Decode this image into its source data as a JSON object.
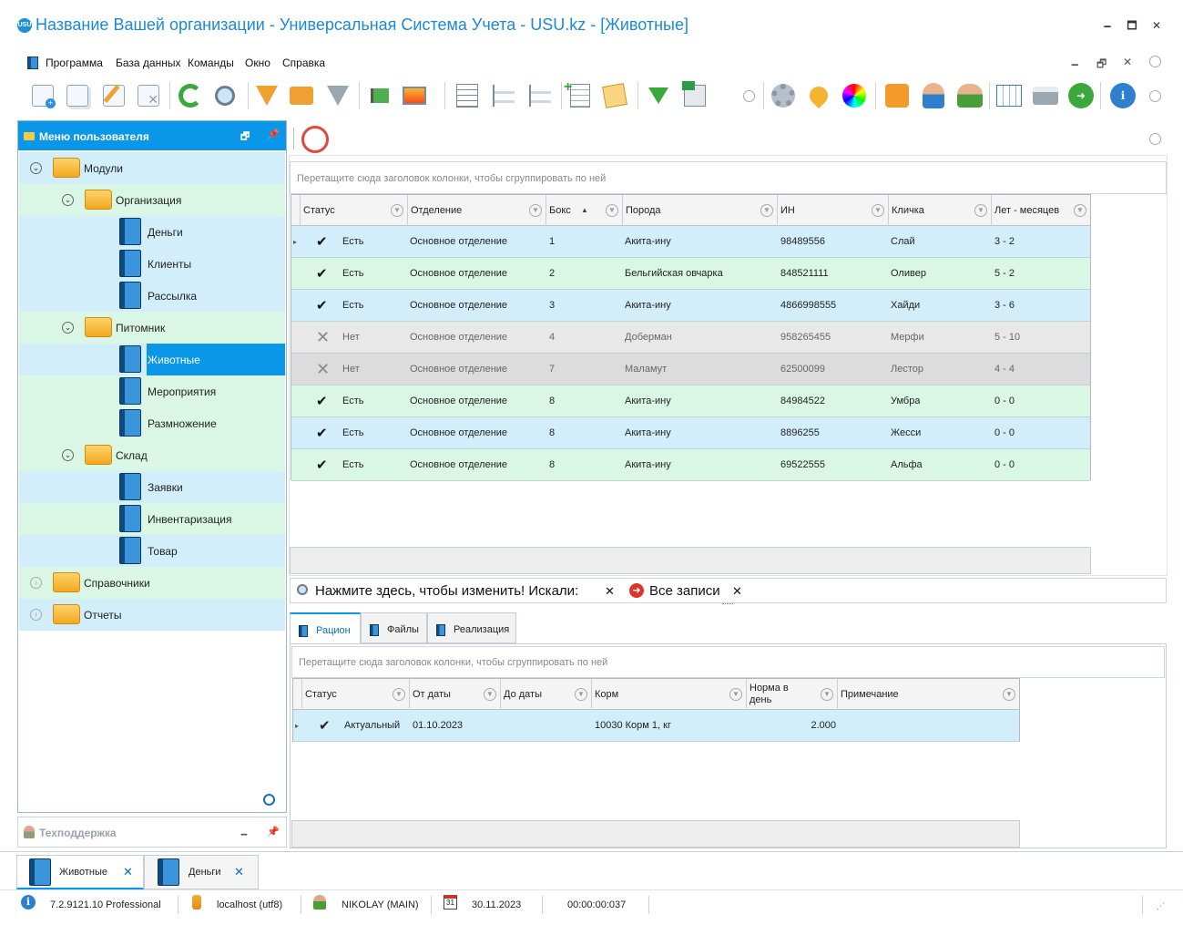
{
  "window": {
    "title": "Название Вашей организации - Универсальная Система Учета - USU.kz - [Животные]",
    "logo_text": "USU",
    "minimize": "🗕",
    "maximize": "🗖",
    "close": "✕"
  },
  "menu": {
    "items": [
      "Программа",
      "База данных",
      "Команды",
      "Окно",
      "Справка"
    ],
    "mdi_minimize": "🗕",
    "mdi_restore": "🗗",
    "mdi_close": "✕"
  },
  "toolbar": {
    "icons": [
      "add-icon",
      "copy-icon",
      "edit-icon",
      "delete-icon",
      "refresh-icon",
      "search-icon",
      "filter-icon",
      "filter-edit-icon",
      "filter-check-icon",
      "flag-icon",
      "image-icon",
      "tree-expand-icon",
      "tree-down-icon",
      "tree-up-icon",
      "add-row-icon",
      "notes-icon",
      "download-icon",
      "export-excel-icon",
      "settings-icon",
      "map-pin-icon",
      "color-wheel-icon",
      "rss-icon",
      "user-icon",
      "users-icon",
      "table-icon",
      "print-icon",
      "arrow-right-icon",
      "info-icon"
    ]
  },
  "left_panel": {
    "title": "Меню пользователя",
    "tree": [
      {
        "label": "Модули",
        "level": 0,
        "type": "folder"
      },
      {
        "label": "Организация",
        "level": 1,
        "type": "folder"
      },
      {
        "label": "Деньги",
        "level": 2,
        "type": "book"
      },
      {
        "label": "Клиенты",
        "level": 2,
        "type": "book"
      },
      {
        "label": "Рассылка",
        "level": 2,
        "type": "book"
      },
      {
        "label": "Питомник",
        "level": 1,
        "type": "folder"
      },
      {
        "label": "Животные",
        "level": 2,
        "type": "book",
        "selected": true
      },
      {
        "label": "Мероприятия",
        "level": 2,
        "type": "book"
      },
      {
        "label": "Размножение",
        "level": 2,
        "type": "book"
      },
      {
        "label": "Склад",
        "level": 1,
        "type": "folder"
      },
      {
        "label": "Заявки",
        "level": 2,
        "type": "book"
      },
      {
        "label": "Инвентаризация",
        "level": 2,
        "type": "book"
      },
      {
        "label": "Товар",
        "level": 2,
        "type": "book"
      },
      {
        "label": "Справочники",
        "level": 0,
        "type": "folder"
      },
      {
        "label": "Отчеты",
        "level": 0,
        "type": "folder"
      }
    ],
    "support_title": "Техподдержка"
  },
  "main_grid": {
    "group_hint": "Перетащите сюда заголовок колонки, чтобы сгруппировать по ней",
    "columns": [
      "Статус",
      "Отделение",
      "Бокс",
      "Порода",
      "ИН",
      "Кличка",
      "Лет - месяцев"
    ],
    "rows": [
      {
        "ok": true,
        "status": "Есть",
        "dept": "Основное отделение",
        "box": "1",
        "breed": "Акита-ину",
        "in": "98489556",
        "name": "Слай",
        "age": "3 - 2",
        "style": "blue"
      },
      {
        "ok": true,
        "status": "Есть",
        "dept": "Основное отделение",
        "box": "2",
        "breed": "Бельгийская овчарка",
        "in": "848521111",
        "name": "Оливер",
        "age": "5 - 2",
        "style": "green"
      },
      {
        "ok": true,
        "status": "Есть",
        "dept": "Основное отделение",
        "box": "3",
        "breed": "Акита-ину",
        "in": "4866998555",
        "name": "Хайди",
        "age": "3 - 6",
        "style": "blue"
      },
      {
        "ok": false,
        "status": "Нет",
        "dept": "Основное отделение",
        "box": "4",
        "breed": "Доберман",
        "in": "958265455",
        "name": "Мерфи",
        "age": "5 - 10",
        "style": "gray1"
      },
      {
        "ok": false,
        "status": "Нет",
        "dept": "Основное отделение",
        "box": "7",
        "breed": "Маламут",
        "in": "62500099",
        "name": "Лестор",
        "age": "4 - 4",
        "style": "gray2"
      },
      {
        "ok": true,
        "status": "Есть",
        "dept": "Основное отделение",
        "box": "8",
        "breed": "Акита-ину",
        "in": "84984522",
        "name": "Умбра",
        "age": "0 - 0",
        "style": "green"
      },
      {
        "ok": true,
        "status": "Есть",
        "dept": "Основное отделение",
        "box": "8",
        "breed": "Акита-ину",
        "in": "8896255",
        "name": "Жесси",
        "age": "0 - 0",
        "style": "blue"
      },
      {
        "ok": true,
        "status": "Есть",
        "dept": "Основное отделение",
        "box": "8",
        "breed": "Акита-ину",
        "in": "69522555",
        "name": "Альфа",
        "age": "0 - 0",
        "style": "green"
      }
    ]
  },
  "search_bar": {
    "prompt": "Нажмите здесь, чтобы изменить! Искали:",
    "all_records": "Все записи",
    "clear": "✕"
  },
  "detail_tabs": [
    "Рацион",
    "Файлы",
    "Реализация"
  ],
  "detail_grid": {
    "group_hint": "Перетащите сюда заголовок колонки, чтобы сгруппировать по ней",
    "columns": [
      "Статус",
      "От даты",
      "До даты",
      "Корм",
      "Норма в день",
      "Примечание"
    ],
    "rows": [
      {
        "status": "Актуальный",
        "from": "01.10.2023",
        "to": "",
        "feed": "10030 Корм 1, кг",
        "norm": "2.000",
        "note": ""
      }
    ]
  },
  "window_tabs": [
    {
      "label": "Животные",
      "close": "✕",
      "active": true
    },
    {
      "label": "Деньги",
      "close": "✕",
      "active": false
    }
  ],
  "status_bar": {
    "version": "7.2.9121.10 Professional",
    "db": "localhost (utf8)",
    "user": "NIKOLAY (MAIN)",
    "calendar_day": "31",
    "date": "30.11.2023",
    "timer": "00:00:00:037"
  }
}
